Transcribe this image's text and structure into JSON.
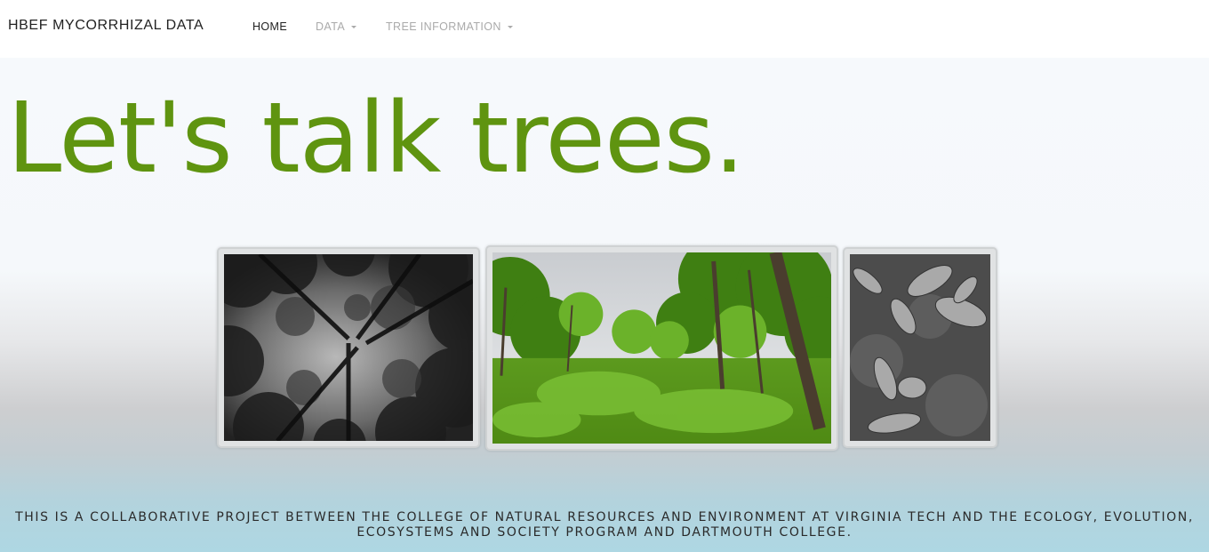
{
  "brand": "HBEF MYCORRHIZAL DATA",
  "nav": {
    "home": "HOME",
    "data": "DATA",
    "tree_info": "TREE INFORMATION"
  },
  "hero": {
    "headline": "Let's talk trees.",
    "photos": [
      {
        "name": "canopy-photo",
        "desc": "black-and-white upward view of tree canopy"
      },
      {
        "name": "forest-photo",
        "desc": "green forest clearing with undergrowth"
      },
      {
        "name": "leaves-photo",
        "desc": "black-and-white fallen leaves on soil"
      }
    ]
  },
  "footer": {
    "text": "THIS IS A COLLABORATIVE PROJECT BETWEEN THE COLLEGE OF NATURAL RESOURCES AND ENVIRONMENT AT VIRGINIA TECH AND THE ECOLOGY, EVOLUTION, ECOSYSTEMS AND SOCIETY PROGRAM AND DARTMOUTH COLLEGE."
  },
  "colors": {
    "headline": "#5f9410",
    "nav_active": "#222222",
    "nav_inactive": "#aaaaaa"
  }
}
